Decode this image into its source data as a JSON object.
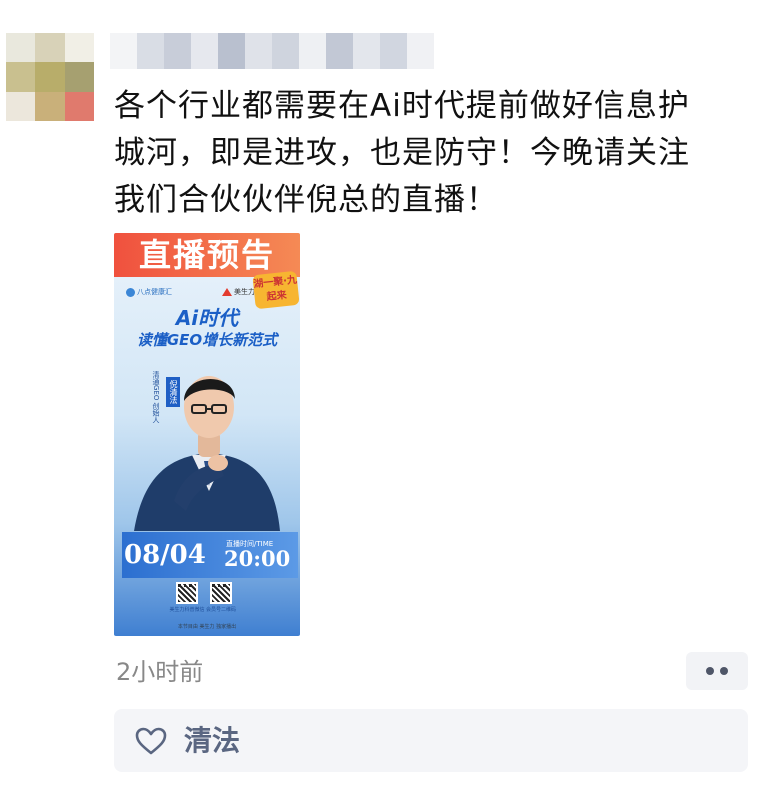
{
  "post": {
    "author_avatar_icon": "avatar-icon",
    "content_lines": [
      "各个行业都需要在Ai时代提前做好信息护",
      "城河，即是进攻，也是防守！今晚请关注",
      "我们合伙伙伴倪总的直播！"
    ],
    "timestamp": "2小时前"
  },
  "poster": {
    "banner": "直播预告",
    "logo_left": "八点健康汇",
    "logo_right": "美生力",
    "badge": "湖一聚·九起来",
    "title_line1": "Ai时代",
    "title_line2": "读懂GEO增长新范式",
    "speaker_name": "倪清法",
    "speaker_desc": "清通GEO 创始人",
    "date": "08/04",
    "time_label": "直播时间/TIME",
    "time": "20:00",
    "qr_left_caption": "美生力科普微信",
    "qr_right_caption": "会员号二维码",
    "footer": "本节目由 美生力 独家播出"
  },
  "actions": {
    "more_icon": "more-dots-icon"
  },
  "likes": {
    "icon": "heart-icon",
    "names": "清法"
  },
  "colors": {
    "banner": "#f0513e",
    "poster_blue": "#1b5fc6",
    "like_name": "#5a6681",
    "timestamp": "#888888"
  }
}
